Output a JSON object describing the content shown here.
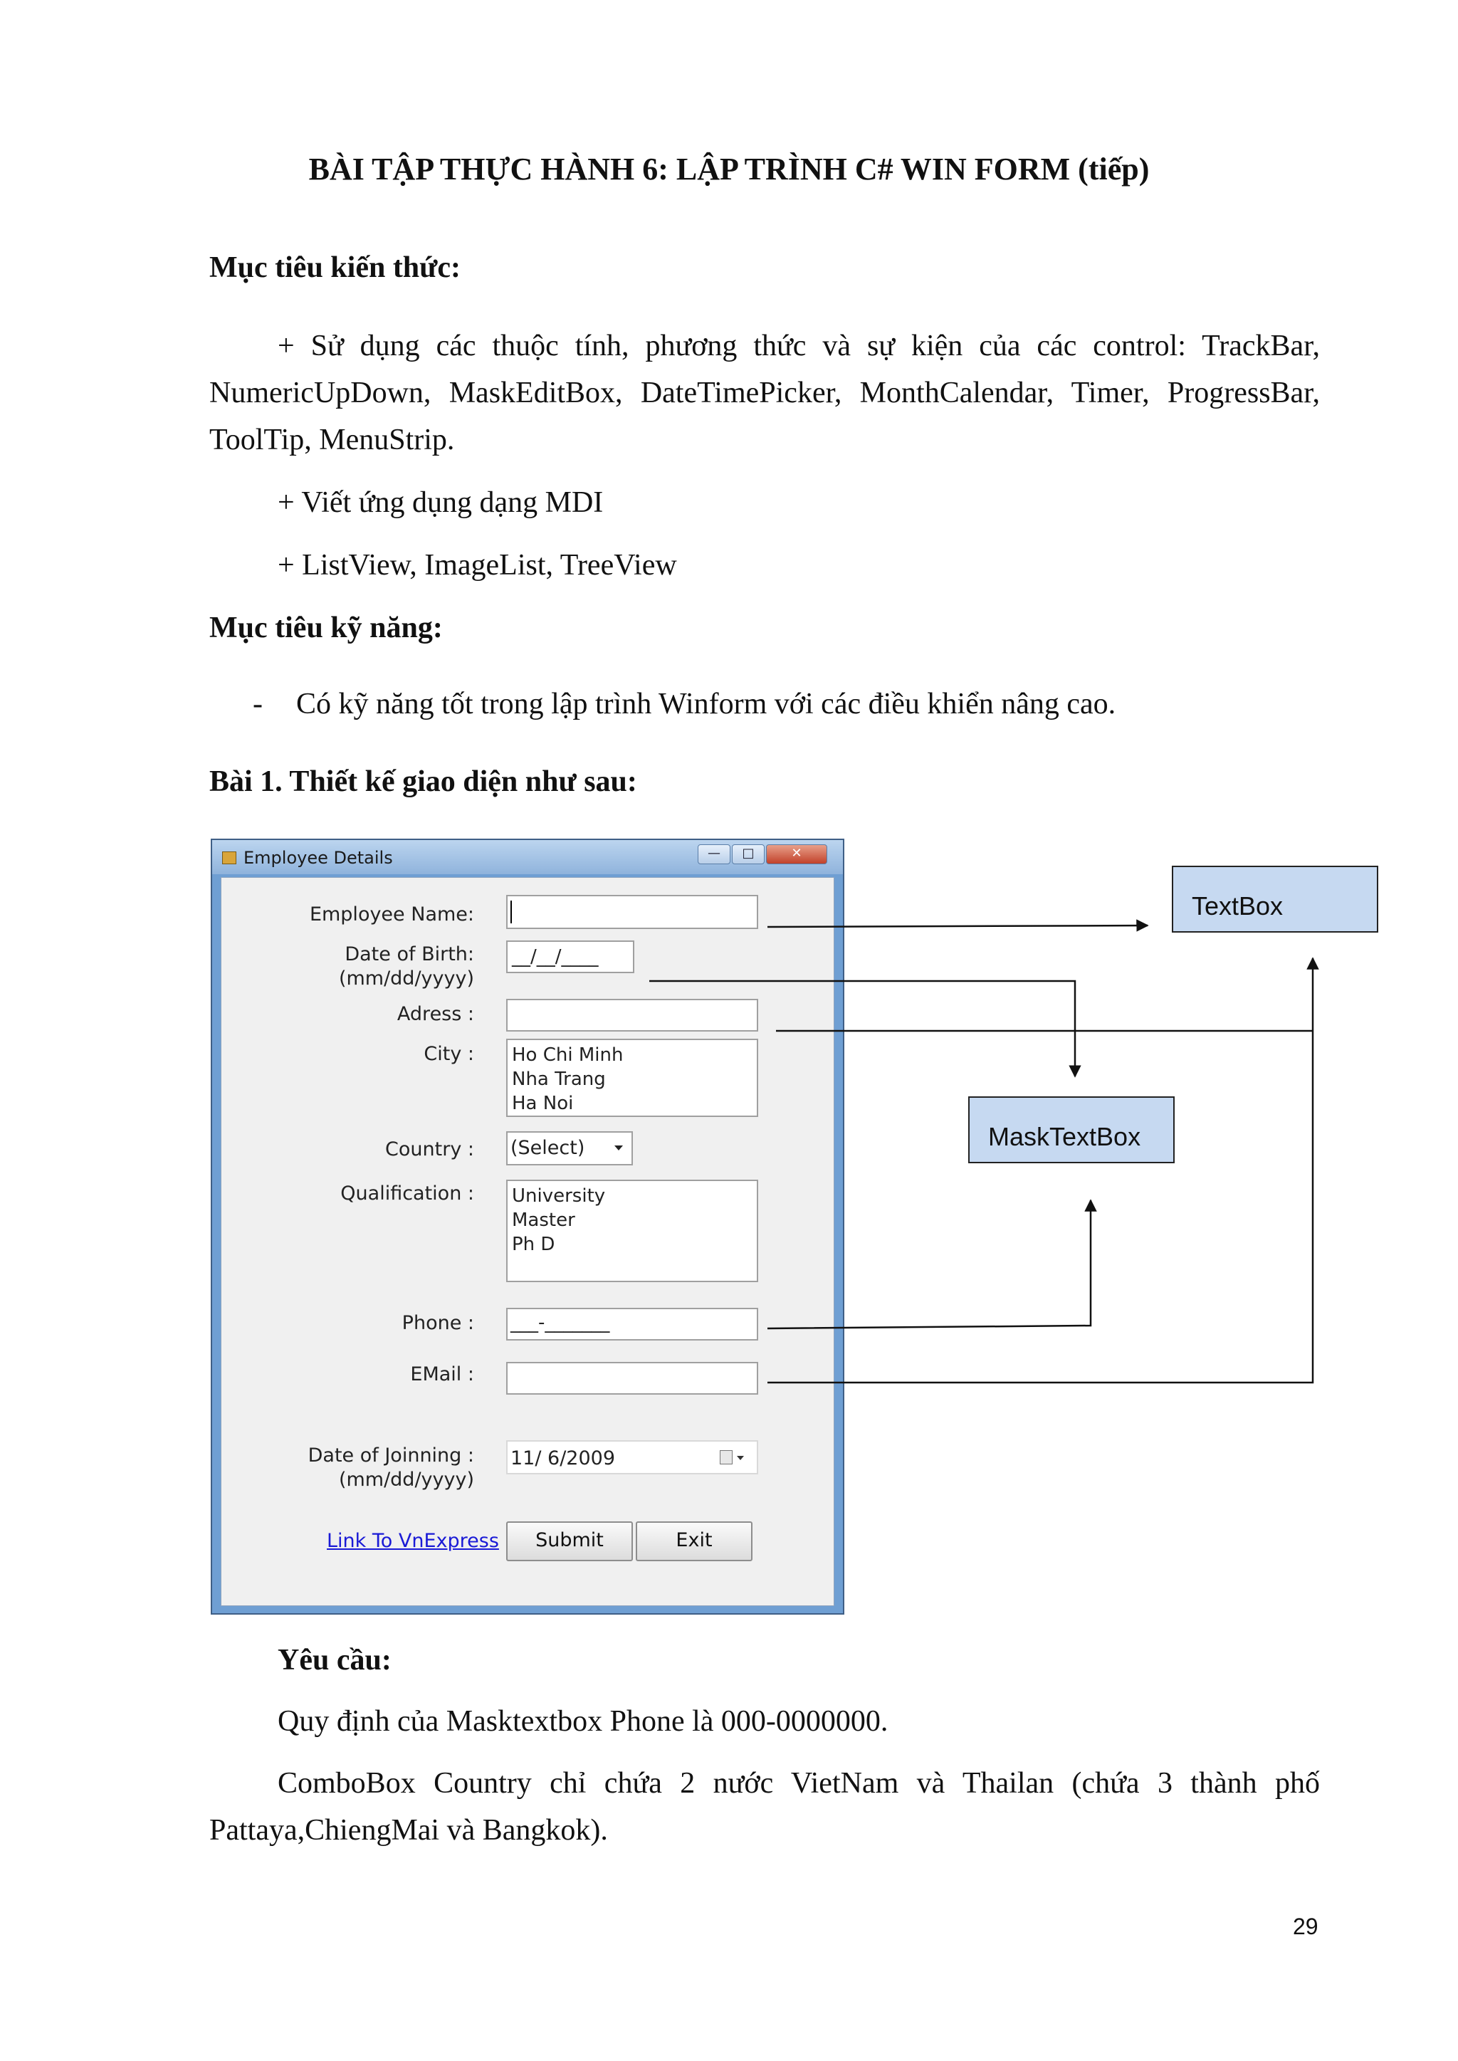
{
  "title": "BÀI TẬP THỰC HÀNH 6: LẬP TRÌNH C# WIN FORM (tiếp)",
  "knowledge": {
    "heading": "Mục tiêu kiến thức:",
    "item1": "+ Sử dụng các thuộc tính, phương thức và sự kiện của các control: TrackBar, NumericUpDown, MaskEditBox, DateTimePicker, MonthCalendar, Timer, ProgressBar, ToolTip, MenuStrip.",
    "item2": "+ Viết ứng dụng dạng MDI",
    "item3": "+ ListView, ImageList, TreeView"
  },
  "skills": {
    "heading": "Mục tiêu kỹ năng:",
    "bullet": "-",
    "item1": "Có kỹ năng tốt trong lập trình Winform với các điều khiển nâng cao."
  },
  "exercise_heading": "Bài 1. Thiết kế giao diện như sau:",
  "form": {
    "window_title": "Employee Details",
    "buttons": {
      "minimize": "—",
      "maximize": "□",
      "close": "✕"
    },
    "labels": {
      "name": "Employee Name:",
      "dob": "Date of Birth:",
      "dob_fmt": "(mm/dd/yyyy)",
      "address": "Adress :",
      "city": "City :",
      "country": "Country :",
      "qualification": "Qualification :",
      "phone": "Phone :",
      "email": "EMail :",
      "doj": "Date of Joinning :",
      "doj_fmt": "(mm/dd/yyyy)"
    },
    "dob_mask": "__/__/____",
    "cities": [
      "Ho Chi Minh",
      "Nha Trang",
      "Ha Noi"
    ],
    "country_selected": "(Select)",
    "qualifications": [
      "University",
      "Master",
      "Ph D"
    ],
    "phone_mask": "___-_______",
    "doj_value": "11/  6/2009",
    "link": "Link To VnExpress",
    "submit": "Submit",
    "exit": "Exit"
  },
  "callouts": {
    "textbox": "TextBox",
    "masktextbox": "MaskTextBox"
  },
  "requirements": {
    "heading": "Yêu cầu:",
    "line1": "Quy định của Masktextbox Phone là 000-0000000.",
    "line2": "ComboBox Country chỉ chứa 2 nước VietNam và Thailan (chứa 3 thành phố Pattaya,ChiengMai và Bangkok)."
  },
  "page_number": "29",
  "colors": {
    "link": "#1a1ad6",
    "callout_fill": "#c6d9f1",
    "window_frame": "#6f9fd3"
  },
  "icons": [
    "app-icon",
    "minimize-icon",
    "maximize-icon",
    "close-icon",
    "dropdown-arrow-icon",
    "calendar-icon"
  ]
}
